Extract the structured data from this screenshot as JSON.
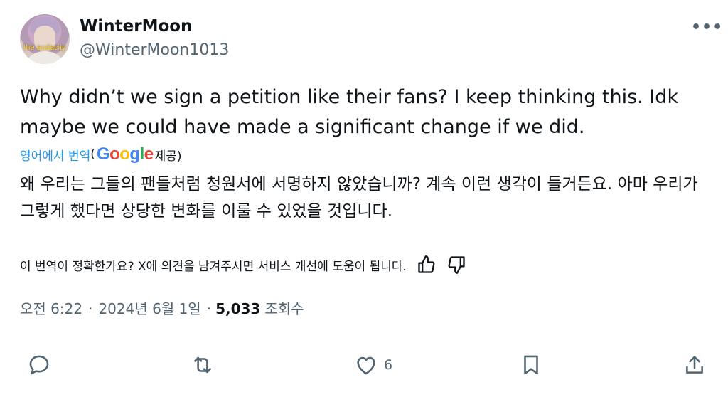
{
  "author": {
    "display_name": "WinterMoon",
    "handle": "@WinterMoon1013",
    "avatar_caption": "the audacity"
  },
  "more_icon": "more-horizontal-icon",
  "tweet": {
    "text": "Why didn’t we sign a petition like their fans? I keep thinking this. Idk maybe we could have made a significant change if we did."
  },
  "translation": {
    "link_label": "영어에서 번역",
    "open_paren": "(",
    "provider": "Google",
    "provided_suffix": "제공)",
    "text": "왜 우리는 그들의 팬들처럼 청원서에 서명하지 않았습니까? 계속 이런 생각이 들거든요. 아마 우리가 그렇게 했다면 상당한 변화를 이룰 수 있었을 것입니다.",
    "feedback_question": "이 번역이 정확한가요? X에 의견을 남겨주시면 서비스 개선에 도움이 됩니다."
  },
  "meta": {
    "time": "오전 6:22",
    "separator": "·",
    "date": "2024년 6월 1일",
    "separator2": "·",
    "views_count": "5,033",
    "views_label": "조회수"
  },
  "actions": {
    "reply_icon": "reply-icon",
    "retweet_icon": "retweet-icon",
    "like_icon": "heart-icon",
    "like_count": "6",
    "bookmark_icon": "bookmark-icon",
    "share_icon": "share-icon"
  },
  "colors": {
    "link": "#1d9bf0",
    "muted": "#536471",
    "text": "#0f1419"
  }
}
